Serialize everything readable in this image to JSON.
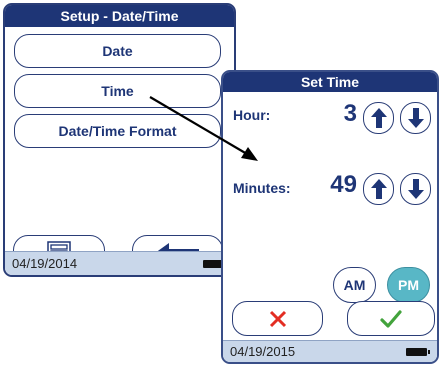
{
  "setup_screen": {
    "title": "Setup - Date/Time",
    "menu": [
      "Date",
      "Time",
      "Date/Time Format"
    ],
    "status_date": "04/19/2014"
  },
  "set_time_screen": {
    "title": "Set Time",
    "hour_label": "Hour:",
    "hour_value": "3",
    "minutes_label": "Minutes:",
    "minutes_value": "49",
    "am_label": "AM",
    "pm_label": "PM",
    "selected_period": "PM",
    "status_date": "04/19/2015"
  },
  "icons": [
    "list-icon",
    "back-arrow-icon",
    "up-arrow-icon",
    "down-arrow-icon",
    "cancel-x-icon",
    "confirm-check-icon",
    "battery-icon"
  ],
  "colors": {
    "navy": "#1e3576",
    "status_bar": "#c9d7ea",
    "pm_selected": "#58b7c6",
    "cancel": "#e32d22",
    "confirm": "#43a33c"
  }
}
